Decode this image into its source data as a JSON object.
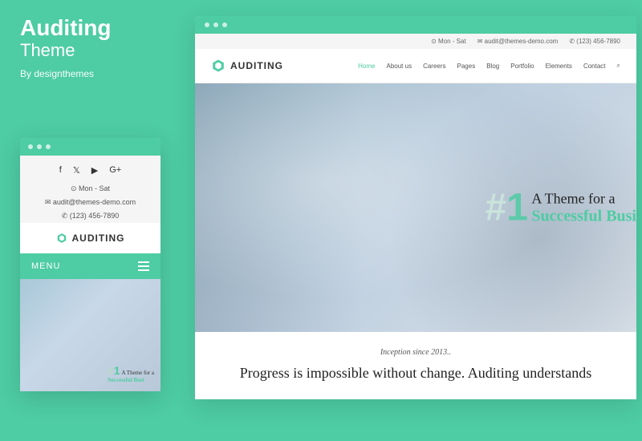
{
  "promo": {
    "title": "Auditing",
    "subtitle": "Theme",
    "author": "By designthemes"
  },
  "brand": {
    "name": "AUDITING",
    "accent": "#4ecca3"
  },
  "topbar": {
    "hours": "Mon - Sat",
    "email": "audit@themes-demo.com",
    "phone": "(123) 456-7890"
  },
  "nav": {
    "items": [
      "Home",
      "About us",
      "Careers",
      "Pages",
      "Blog",
      "Portfolio",
      "Elements",
      "Contact"
    ],
    "active": "Home"
  },
  "mobile": {
    "menu_label": "MENU",
    "hours": "⊙ Mon - Sat",
    "email": "✉ audit@themes-demo.com",
    "phone": "✆ (123) 456-7890"
  },
  "hero": {
    "hash": "#",
    "num": "1",
    "line1": "A Theme for a",
    "line2": "Successful Busi"
  },
  "content": {
    "inception": "Inception since 2013..",
    "headline": "Progress is impossible without change. Auditing understands"
  },
  "social": [
    "facebook",
    "twitter",
    "youtube",
    "google-plus"
  ]
}
